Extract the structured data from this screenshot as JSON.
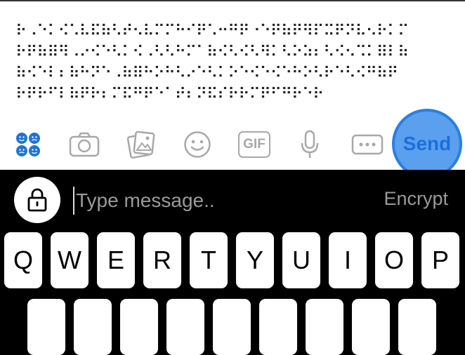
{
  "compose": {
    "cipher_lines": [
      "⠗⠠⠑⠅⠪⠡⠧⠯⠷⠣⠞⠢⠧⠍⠍⠓⠊⠟⠡⠒⠛⠟⠐⠑⠟⠷⠟⠻⠏⠭⠟⠝⠧⠢⠗⠅⠍",
      "⠗⠟⠷⠿⠻⠠⠔⠪⠑⠣⠅⠪⠠⠣⠣⠓⠍⠁⠷⠪⠣⠪⠣⠻⠅⠣⠕⠵⠆⠣⠪⠢⠩⠅⠿⠇⠷",
      "⠷⠪⠑⠇⠆⠷⠓⠝⠑⠠⠷⠿⠓⠕⠓⠣⠔⠑⠣⠅⠕⠑⠪⠑⠪⠑⠓⠕⠣⠗⠑⠣⠪⠛⠷⠟",
      "⠗⠟⠗⠋⠇⠷⠟⠗⠆⠍⠯⠛⠟⠑⠁⠞⠆⠝⠯⠎⠗⠗⠍⠟⠋⠛⠗⠑⠗"
    ]
  },
  "toolbar": {
    "emoji_grid_icon": "emoji-grid",
    "camera_icon": "camera",
    "gallery_icon": "photo-gallery",
    "smiley_icon": "smiley",
    "gif_label": "GIF",
    "mic_icon": "microphone",
    "more_icon": "more-dots",
    "send_label": "Send"
  },
  "input": {
    "placeholder": "Type message..",
    "encrypt_label": "Encrypt",
    "lock_icon": "lock"
  },
  "keyboard": {
    "row1": [
      "Q",
      "W",
      "E",
      "R",
      "T",
      "Y",
      "U",
      "I",
      "O",
      "P"
    ]
  },
  "colors": {
    "accent": "#2a7fe0",
    "emoji_blue": "#1e74d6",
    "icon_gray": "#a8a8a8",
    "placeholder_gray": "#9a9a9a"
  }
}
